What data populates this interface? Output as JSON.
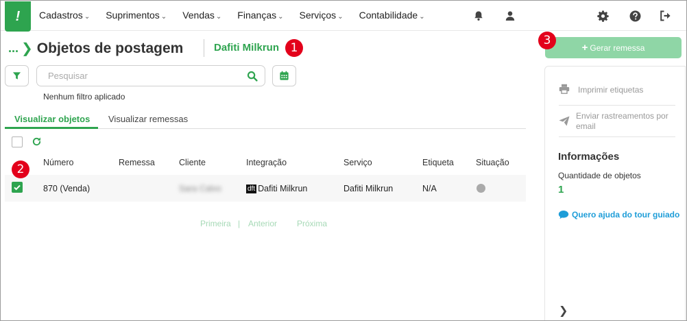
{
  "nav": {
    "logo": "!",
    "menu": [
      "Cadastros",
      "Suprimentos",
      "Vendas",
      "Finanças",
      "Serviços",
      "Contabilidade"
    ]
  },
  "page": {
    "breadcrumb_dots": "...",
    "title": "Objetos de postagem",
    "store": "Dafiti Milkrun"
  },
  "annotations": [
    "1",
    "2",
    "3"
  ],
  "search": {
    "placeholder": "Pesquisar"
  },
  "filter_status": "Nenhum filtro aplicado",
  "tabs": [
    "Visualizar objetos",
    "Visualizar remessas"
  ],
  "table": {
    "headers": [
      "Número",
      "Remessa",
      "Cliente",
      "Integração",
      "Serviço",
      "Etiqueta",
      "Situação"
    ],
    "rows": [
      {
        "numero": "870 (Venda)",
        "remessa": "",
        "cliente": "Sara Calvo",
        "integracao_badge": "dft",
        "integracao": "Dafiti Milkrun",
        "servico": "Dafiti Milkrun",
        "etiqueta": "N/A",
        "checked": true
      }
    ]
  },
  "pagination": {
    "first": "Primeira",
    "sep": "|",
    "prev": "Anterior",
    "next": "Próxima"
  },
  "sidebar": {
    "generate_button": "Gerar remessa",
    "print_labels": "Imprimir etiquetas",
    "send_tracking": "Enviar rastreamentos por email",
    "info_title": "Informações",
    "qty_label": "Quantidade de objetos",
    "qty_value": "1",
    "help": "Quero ajuda do tour guiado"
  },
  "colors": {
    "brand": "#2ea44f",
    "annotation": "#e3001b",
    "link": "#1e9dd8"
  }
}
